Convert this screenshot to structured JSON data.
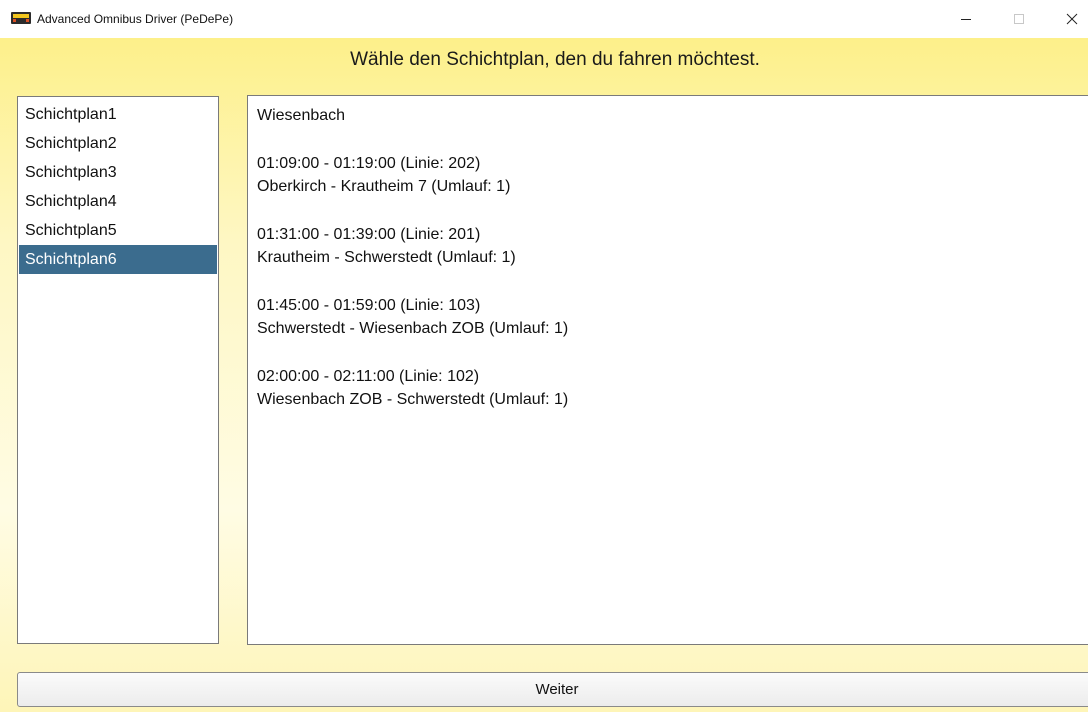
{
  "window": {
    "title": "Advanced Omnibus Driver (PeDePe)",
    "icon": "bus-app-icon",
    "controls": {
      "minimize_glyph": "–",
      "maximize_glyph": "□",
      "close_glyph": "✕"
    }
  },
  "header": {
    "prompt": "Wähle den Schichtplan, den du fahren möchtest."
  },
  "schedule_list": {
    "items": [
      "Schichtplan1",
      "Schichtplan2",
      "Schichtplan3",
      "Schichtplan4",
      "Schichtplan5",
      "Schichtplan6"
    ],
    "selected": "Schichtplan6"
  },
  "details": {
    "location": "Wiesenbach",
    "trips": [
      {
        "time": "01:09:00 - 01:19:00 (Linie: 202)",
        "route": "Oberkirch - Krautheim 7 (Umlauf: 1)"
      },
      {
        "time": "01:31:00 - 01:39:00 (Linie: 201)",
        "route": "Krautheim - Schwerstedt (Umlauf: 1)"
      },
      {
        "time": "01:45:00 - 01:59:00 (Linie: 103)",
        "route": "Schwerstedt - Wiesenbach ZOB (Umlauf: 1)"
      },
      {
        "time": "02:00:00 - 02:11:00 (Linie: 102)",
        "route": "Wiesenbach ZOB - Schwerstedt (Umlauf: 1)"
      }
    ]
  },
  "footer": {
    "continue_label": "Weiter"
  },
  "colors": {
    "selection": "#3b6c8e",
    "background_top": "#fdf08a",
    "background_bottom": "#fef5b8"
  }
}
